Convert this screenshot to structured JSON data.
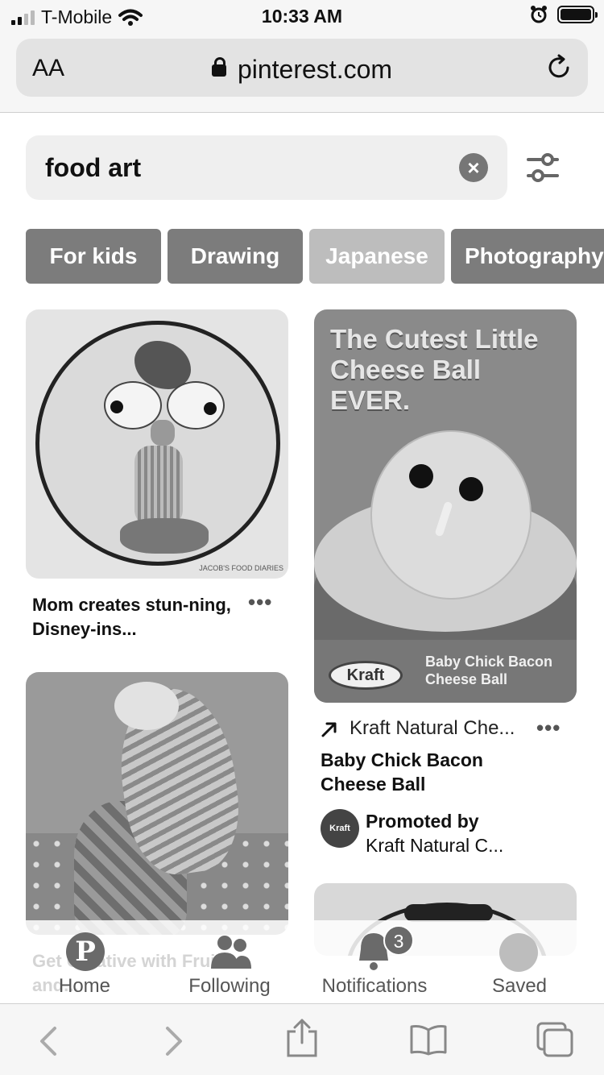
{
  "status_bar": {
    "carrier": "T-Mobile",
    "time": "10:33 AM"
  },
  "address_bar": {
    "text_size_label": "AA",
    "domain": "pinterest.com"
  },
  "search": {
    "query": "food art"
  },
  "chips": [
    "For kids",
    "Drawing",
    "Japanese",
    "Photography"
  ],
  "pins": {
    "first": {
      "credit": "JACOB'S FOOD DIARIES",
      "title": "Mom creates stun-ning, Disney-ins..."
    },
    "second": {
      "headline": "The Cutest Little Cheese Ball EVER.",
      "brand": "Kraft",
      "band_text": "Baby Chick Bacon Cheese Ball",
      "source": "Kraft Natural Che...",
      "title": "Baby Chick Bacon Cheese Ball",
      "promoted_label": "Promoted by",
      "promoter": "Kraft Natural C...",
      "avatar_text": "Kraft"
    },
    "third": {
      "title_partial": "Get Creative with Fruits and..."
    }
  },
  "tab_bar": {
    "home": "Home",
    "following": "Following",
    "notifications": "Notifications",
    "notifications_badge": "3",
    "saved": "Saved",
    "pinterest_logo": "P"
  },
  "more_label": "•••",
  "clear_label": "×",
  "colors": {
    "chip": "#7c7c7c",
    "chip_selected": "#bdbdbd",
    "search_bg": "#efefef"
  },
  "icons": [
    "search-clear-icon",
    "filter-sliders-icon",
    "reload-icon",
    "lock-icon",
    "back-icon",
    "forward-icon",
    "share-icon",
    "bookmarks-icon",
    "tabs-icon"
  ]
}
